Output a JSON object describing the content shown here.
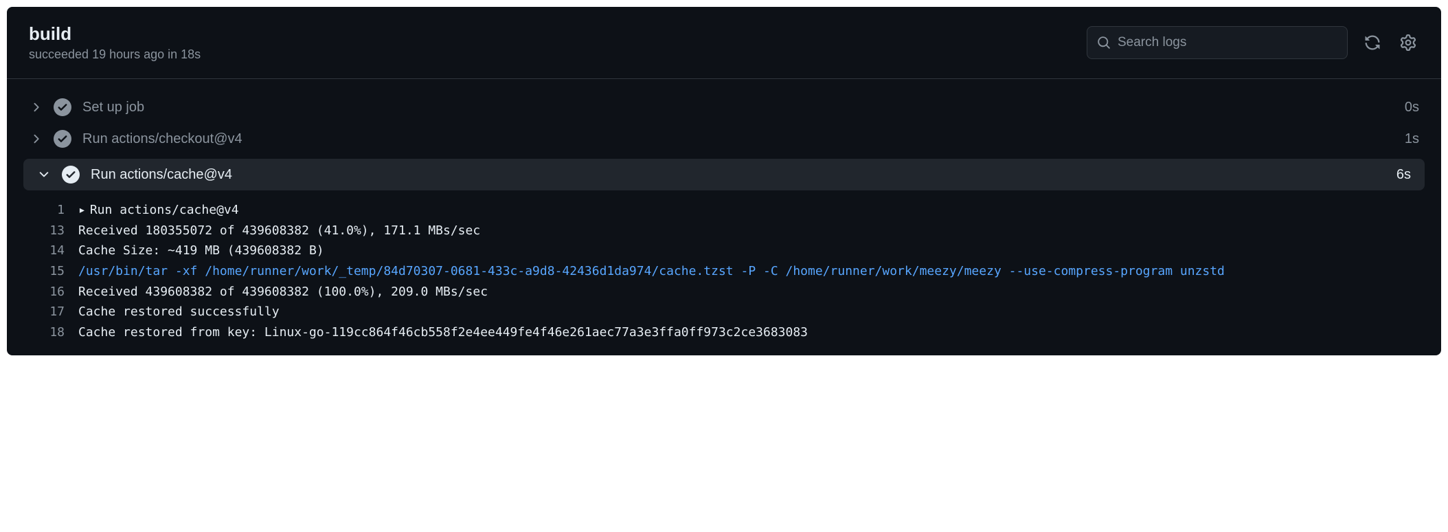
{
  "header": {
    "title": "build",
    "status": "succeeded 19 hours ago in 18s",
    "search_placeholder": "Search logs"
  },
  "steps": [
    {
      "name": "Set up job",
      "duration": "0s",
      "expanded": false,
      "highlighted": false
    },
    {
      "name": "Run actions/checkout@v4",
      "duration": "1s",
      "expanded": false,
      "highlighted": false
    },
    {
      "name": "Run actions/cache@v4",
      "duration": "6s",
      "expanded": true,
      "highlighted": true
    }
  ],
  "logs": [
    {
      "n": "1",
      "text": "Run actions/cache@v4",
      "disclosure": true,
      "cmd": false
    },
    {
      "n": "13",
      "text": "Received 180355072 of 439608382 (41.0%), 171.1 MBs/sec",
      "cmd": false
    },
    {
      "n": "14",
      "text": "Cache Size: ~419 MB (439608382 B)",
      "cmd": false
    },
    {
      "n": "15",
      "text": "/usr/bin/tar -xf /home/runner/work/_temp/84d70307-0681-433c-a9d8-42436d1da974/cache.tzst -P -C /home/runner/work/meezy/meezy --use-compress-program unzstd",
      "cmd": true
    },
    {
      "n": "16",
      "text": "Received 439608382 of 439608382 (100.0%), 209.0 MBs/sec",
      "cmd": false
    },
    {
      "n": "17",
      "text": "Cache restored successfully",
      "cmd": false
    },
    {
      "n": "18",
      "text": "Cache restored from key: Linux-go-119cc864f46cb558f2e4ee449fe4f46e261aec77a3e3ffa0ff973c2ce3683083",
      "cmd": false
    }
  ]
}
